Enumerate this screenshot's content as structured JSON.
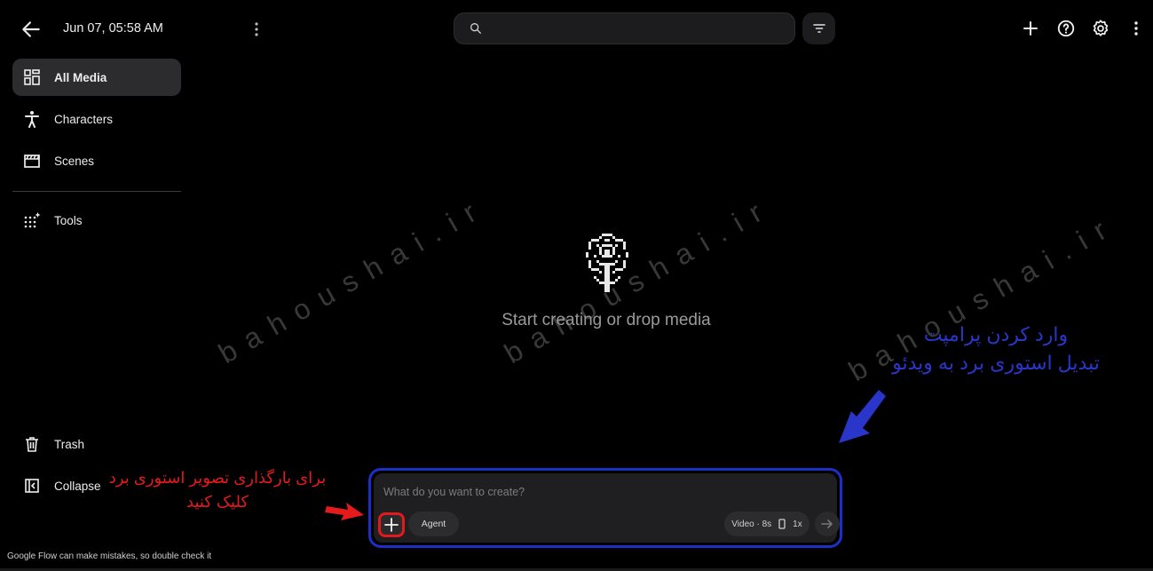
{
  "header": {
    "back_icon": "arrow-left-icon",
    "title": "Jun 07, 05:58 AM",
    "search_placeholder": "",
    "icons": [
      "more-vert-icon",
      "search-icon",
      "filter-icon",
      "plus-icon",
      "help-icon",
      "gear-icon",
      "more-vert-icon"
    ]
  },
  "sidebar": {
    "items": [
      {
        "label": "All Media",
        "icon": "grid-icon",
        "active": true
      },
      {
        "label": "Characters",
        "icon": "person-icon"
      },
      {
        "label": "Scenes",
        "icon": "clapperboard-icon"
      },
      {
        "label": "Tools",
        "icon": "sparkle-grid-icon"
      }
    ],
    "trash_label": "Trash",
    "collapse_label": "Collapse"
  },
  "empty_state": {
    "icon": "pixel-flower-icon",
    "message": "Start creating or drop media"
  },
  "composer": {
    "placeholder": "What do you want to create?",
    "agent_label": "Agent",
    "mode_label": "Video · 8s",
    "count_label": "1x",
    "icons": [
      "plus-icon",
      "phone-portrait-icon",
      "arrow-right-icon"
    ]
  },
  "annotations": {
    "red_line1": "برای بارگذاری تصویر استوری برد",
    "red_line2": "کلیک کنید",
    "blue_line1": "وارد کردن پرامپت",
    "blue_line2": "تبدیل استوری برد به ویدئو"
  },
  "watermark": "bahoushai.ir",
  "footer": {
    "disclaimer": "Google Flow can make mistakes, so double check it"
  },
  "colors": {
    "background": "#000000",
    "annotation_red": "#e51b1b",
    "annotation_blue": "#2a36c9",
    "composer_border": "#1c2fc6"
  }
}
